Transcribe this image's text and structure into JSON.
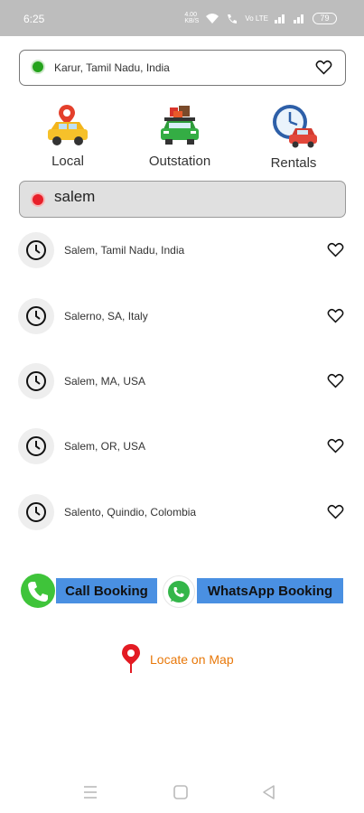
{
  "status_bar": {
    "time": "6:25",
    "network_speed": "4.00 KB/S",
    "signal": "Vo LTE",
    "battery": "79"
  },
  "pickup": {
    "location": "Karur, Tamil Nadu, India",
    "dot_color": "#25a31c"
  },
  "services": [
    {
      "label": "Local",
      "icon": "taxi-icon"
    },
    {
      "label": "Outstation",
      "icon": "loaded-car-icon"
    },
    {
      "label": "Rentals",
      "icon": "clock-car-icon"
    }
  ],
  "search": {
    "query": "salem",
    "dot_color": "#e8202a"
  },
  "results": [
    {
      "label": "Salem, Tamil Nadu, India"
    },
    {
      "label": "Salerno, SA, Italy"
    },
    {
      "label": "Salem, MA, USA"
    },
    {
      "label": "Salem, OR, USA"
    },
    {
      "label": "Salento, Quindio, Colombia"
    }
  ],
  "booking": {
    "call_label": "Call Booking",
    "whatsapp_label": "WhatsApp Booking",
    "button_color": "#4a90e2"
  },
  "locate": {
    "label": "Locate on Map",
    "color": "#e8780a"
  },
  "nav": [
    "menu-icon",
    "home-icon",
    "back-icon"
  ]
}
